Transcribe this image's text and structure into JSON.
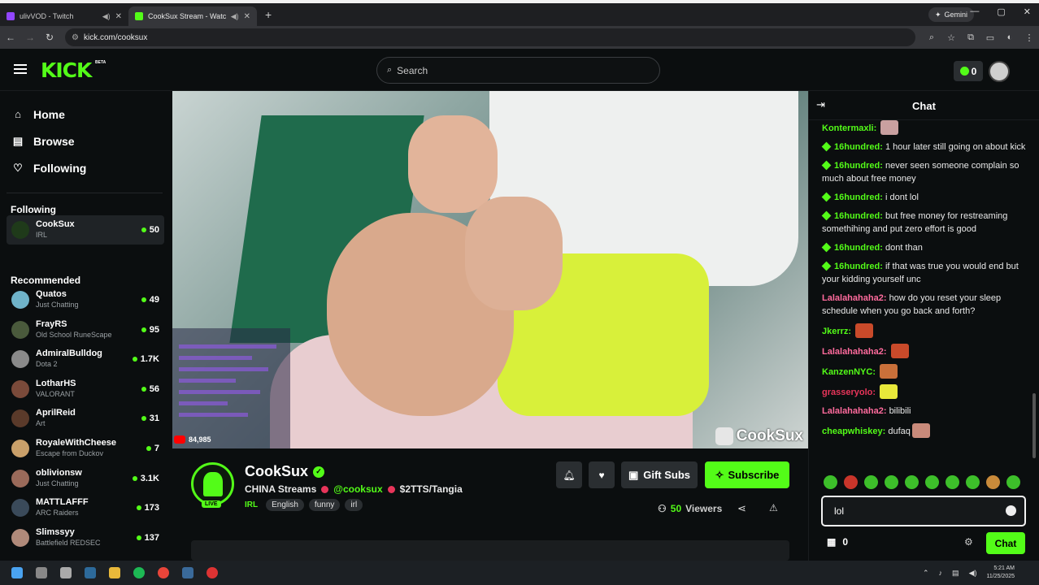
{
  "browser": {
    "tabs": [
      {
        "title": "ulivVOD - Twitch",
        "favicon_color": "#9146ff",
        "active": false
      },
      {
        "title": "CookSux Stream - Watch Li...",
        "favicon_color": "#53fc18",
        "active": true
      }
    ],
    "gemini_label": "Gemini",
    "url": "kick.com/cooksux"
  },
  "header": {
    "logo": "KICK",
    "beta": "BETA",
    "search_placeholder": "Search",
    "wallet_count": "0"
  },
  "sidebar": {
    "nav": [
      {
        "label": "Home",
        "icon": "home-icon",
        "glyph": "⌂"
      },
      {
        "label": "Browse",
        "icon": "browse-icon",
        "glyph": "▤"
      },
      {
        "label": "Following",
        "icon": "heart-icon",
        "glyph": "♡"
      }
    ],
    "following_title": "Following",
    "following": [
      {
        "name": "CookSux",
        "category": "IRL",
        "viewers": "50",
        "color": "#1f3a1a"
      }
    ],
    "recommended_title": "Recommended",
    "recommended": [
      {
        "name": "Quatos",
        "category": "Just Chatting",
        "viewers": "49",
        "color": "#6fb3c9"
      },
      {
        "name": "FrayRS",
        "category": "Old School RuneScape",
        "viewers": "95",
        "color": "#4a5a3c"
      },
      {
        "name": "AdmiralBulldog",
        "category": "Dota 2",
        "viewers": "1.7K",
        "color": "#8a8a8a"
      },
      {
        "name": "LotharHS",
        "category": "VALORANT",
        "viewers": "56",
        "color": "#7a4a3a"
      },
      {
        "name": "AprilReid",
        "category": "Art",
        "viewers": "31",
        "color": "#5a3a2a"
      },
      {
        "name": "RoyaleWithCheese",
        "category": "Escape from Duckov",
        "viewers": "7",
        "color": "#c9a06a"
      },
      {
        "name": "oblivionsw",
        "category": "Just Chatting",
        "viewers": "3.1K",
        "color": "#9a6a5a"
      },
      {
        "name": "MATTLAFFF",
        "category": "ARC Raiders",
        "viewers": "173",
        "color": "#3a4a5a"
      },
      {
        "name": "Slimssyy",
        "category": "Battlefield REDSEC",
        "viewers": "137",
        "color": "#b08a7a"
      }
    ]
  },
  "video": {
    "yt_count": "84,985",
    "watermark": "CookSux"
  },
  "stream": {
    "name": "CookSux",
    "live": "LIVE",
    "title_parts": [
      "CHINA Streams",
      "@cooksux",
      "$2TTS/Tangia"
    ],
    "category": "IRL",
    "tags": [
      "English",
      "funny",
      "irl"
    ],
    "gift_label": "Gift Subs",
    "subscribe_label": "Subscribe",
    "viewers": "50",
    "viewers_label": "Viewers"
  },
  "chat": {
    "title": "Chat",
    "messages": [
      {
        "user": "Kontermaxli",
        "color": "#53fc18",
        "text": "",
        "badge": false,
        "emote": "#c9a0a0"
      },
      {
        "user": "16hundred",
        "color": "#53fc18",
        "text": "1 hour later still going on about kick",
        "badge": true
      },
      {
        "user": "16hundred",
        "color": "#53fc18",
        "text": "never seen someone complain so much about free money",
        "badge": true
      },
      {
        "user": "16hundred",
        "color": "#53fc18",
        "text": "i dont lol",
        "badge": true
      },
      {
        "user": "16hundred",
        "color": "#53fc18",
        "text": "but free money for restreaming somethihing and put zero effort is good",
        "badge": true
      },
      {
        "user": "16hundred",
        "color": "#53fc18",
        "text": "dont than",
        "badge": true
      },
      {
        "user": "16hundred",
        "color": "#53fc18",
        "text": "if that was true you would end but your kidding yourself unc",
        "badge": true
      },
      {
        "user": "Lalalahahaha2",
        "color": "#ff6b9d",
        "text": "how do you reset your sleep schedule when you go back and forth?",
        "badge": false
      },
      {
        "user": "Jkerrz",
        "color": "#53fc18",
        "text": "",
        "badge": false,
        "emote": "#c94a2a"
      },
      {
        "user": "Lalalahahaha2",
        "color": "#ff6b9d",
        "text": "",
        "badge": false,
        "emote": "#c94a2a"
      },
      {
        "user": "KanzenNYC",
        "color": "#53fc18",
        "text": "",
        "badge": false,
        "emote": "#c9703a"
      },
      {
        "user": "grasseryolo",
        "color": "#e8355a",
        "text": "",
        "badge": false,
        "emote": "#e8e83a"
      },
      {
        "user": "Lalalahahaha2",
        "color": "#ff6b9d",
        "text": "bilibili",
        "badge": false
      },
      {
        "user": "cheapwhiskey",
        "color": "#53fc18",
        "text": "dufaq",
        "badge": false,
        "emote": "#c98a7a"
      }
    ],
    "input_value": "lol",
    "points": "0",
    "send_label": "Chat"
  },
  "taskbar": {
    "time": "5:21 AM",
    "date": "11/25/2025"
  }
}
